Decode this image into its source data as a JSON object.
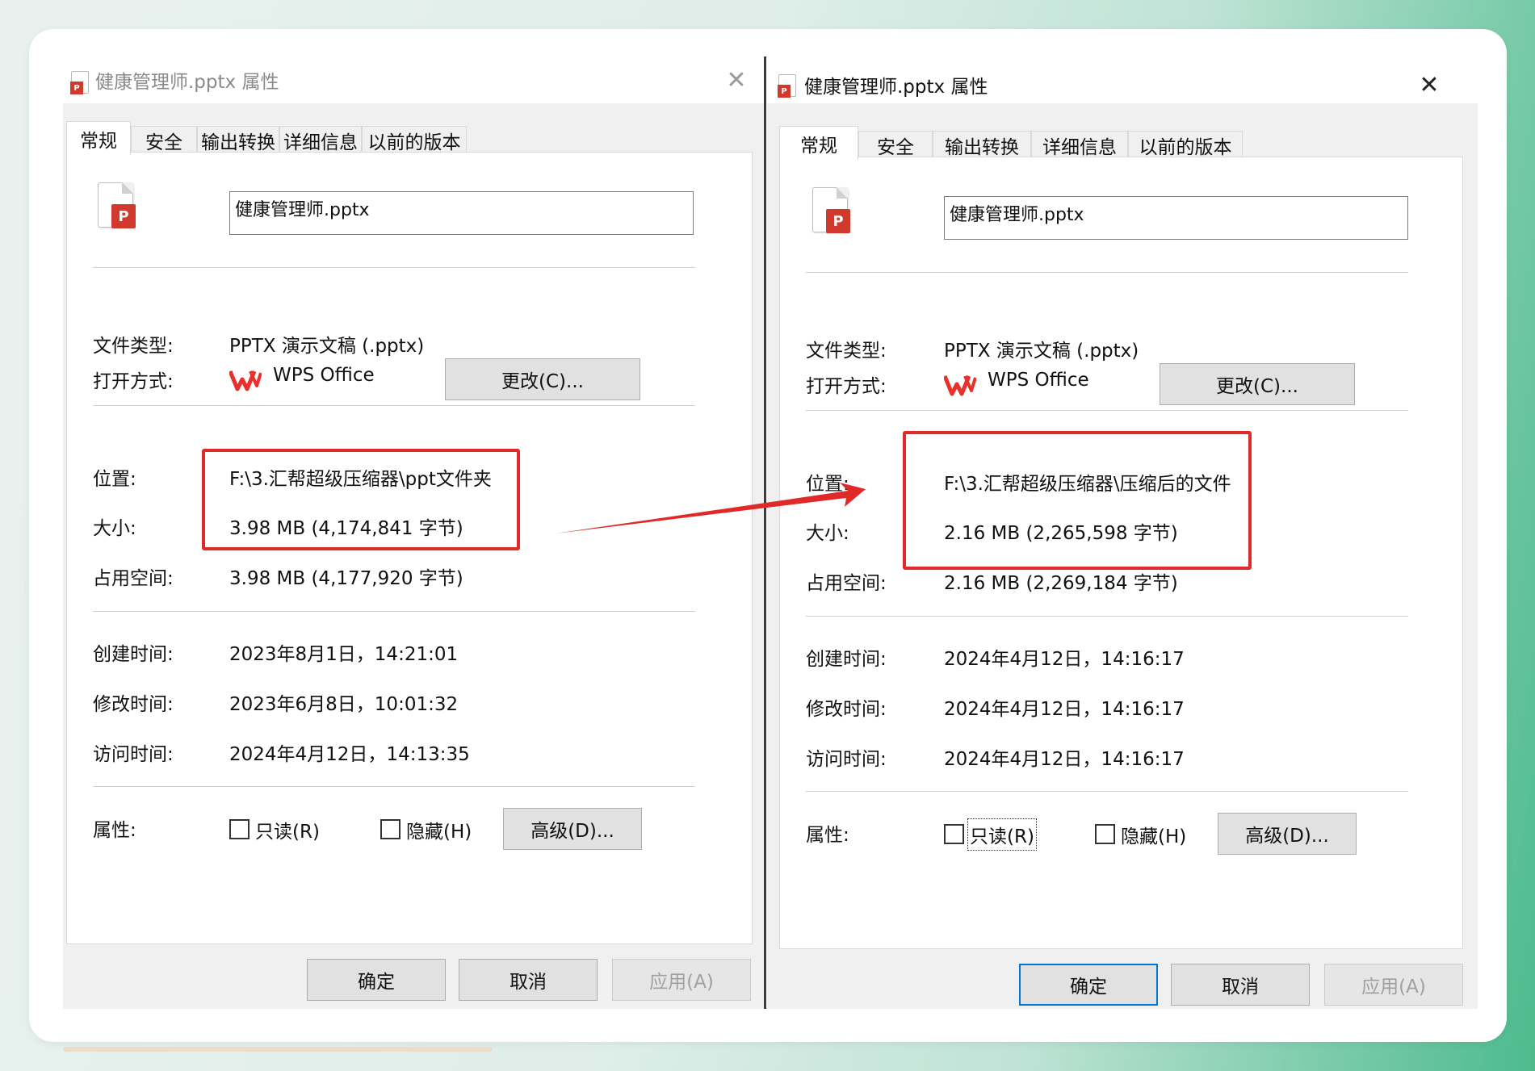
{
  "left": {
    "title": "健康管理师.pptx 属性",
    "tabs": [
      "常规",
      "安全",
      "输出转换",
      "详细信息",
      "以前的版本"
    ],
    "file_name": "健康管理师.pptx",
    "file_type_label": "文件类型:",
    "file_type": "PPTX 演示文稿 (.pptx)",
    "open_with_label": "打开方式:",
    "open_with_app": "WPS Office",
    "change_button": "更改(C)...",
    "location_label": "位置:",
    "location": "F:\\3.汇帮超级压缩器\\ppt文件夹",
    "size_label": "大小:",
    "size": "3.98 MB (4,174,841 字节)",
    "disk_size_label": "占用空间:",
    "disk_size": "3.98 MB (4,177,920 字节)",
    "created_label": "创建时间:",
    "created": "2023年8月1日，14:21:01",
    "modified_label": "修改时间:",
    "modified": "2023年6月8日，10:01:32",
    "accessed_label": "访问时间:",
    "accessed": "2024年4月12日，14:13:35",
    "attributes_label": "属性:",
    "readonly_label": "只读(R)",
    "hidden_label": "隐藏(H)",
    "advanced_button": "高级(D)...",
    "ok_button": "确定",
    "cancel_button": "取消",
    "apply_button": "应用(A)"
  },
  "right": {
    "title": "健康管理师.pptx 属性",
    "tabs": [
      "常规",
      "安全",
      "输出转换",
      "详细信息",
      "以前的版本"
    ],
    "file_name": "健康管理师.pptx",
    "file_type_label": "文件类型:",
    "file_type": "PPTX 演示文稿 (.pptx)",
    "open_with_label": "打开方式:",
    "open_with_app": "WPS Office",
    "change_button": "更改(C)...",
    "location_label": "位置:",
    "location": "F:\\3.汇帮超级压缩器\\压缩后的文件",
    "size_label": "大小:",
    "size": "2.16 MB (2,265,598 字节)",
    "disk_size_label": "占用空间:",
    "disk_size": "2.16 MB (2,269,184 字节)",
    "created_label": "创建时间:",
    "created": "2024年4月12日，14:16:17",
    "modified_label": "修改时间:",
    "modified": "2024年4月12日，14:16:17",
    "accessed_label": "访问时间:",
    "accessed": "2024年4月12日，14:16:17",
    "attributes_label": "属性:",
    "readonly_label": "只读(R)",
    "hidden_label": "隐藏(H)",
    "advanced_button": "高级(D)...",
    "ok_button": "确定",
    "cancel_button": "取消",
    "apply_button": "应用(A)"
  },
  "colors": {
    "highlight": "#e02a2a",
    "primary_focus": "#0078d7",
    "file_badge": "#d0392b",
    "wps_logo": "#e8312b"
  },
  "icons": {
    "file": "pptx-file-icon",
    "app": "wps-logo-icon",
    "close": "close-icon"
  }
}
